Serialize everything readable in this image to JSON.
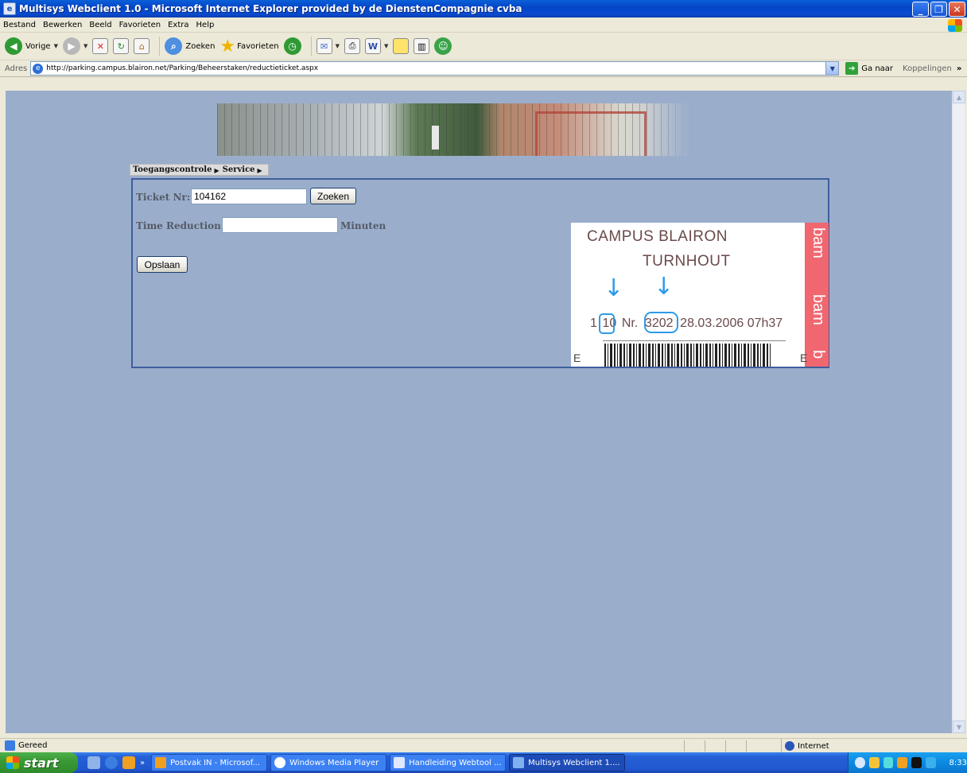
{
  "window": {
    "title": "Multisys Webclient 1.0 - Microsoft Internet Explorer provided by de DienstenCompagnie cvba"
  },
  "menu": [
    "Bestand",
    "Bewerken",
    "Beeld",
    "Favorieten",
    "Extra",
    "Help"
  ],
  "toolbar": {
    "back_label": "Vorige",
    "search_label": "Zoeken",
    "favorites_label": "Favorieten"
  },
  "address": {
    "label": "Adres",
    "url": "http://parking.campus.blairon.net/Parking/Beheerstaken/reductieticket.aspx",
    "go_label": "Ga naar",
    "links_label": "Koppelingen"
  },
  "breadcrumb": [
    "Toegangscontrole",
    "Service"
  ],
  "form": {
    "ticket_label": "Ticket Nr:",
    "ticket_value": "104162",
    "search_button": "Zoeken",
    "reduction_label": "Time Reduction:",
    "reduction_value": "",
    "unit_label": "Minuten",
    "save_button": "Opslaan"
  },
  "ticket_image": {
    "line1": "CAMPUS BLAIRON",
    "line2": "TURNHOUT",
    "prefix": "1",
    "num1": "10",
    "nr_label": "Nr.",
    "num2": "3202",
    "datetime": "28.03.2006 07h37",
    "stripe_text1": "bam",
    "stripe_text2": "bam",
    "stripe_text3": "b",
    "corner_left": "E",
    "corner_right": "E"
  },
  "status": {
    "text": "Gereed",
    "zone": "Internet"
  },
  "taskbar": {
    "start_label": "start",
    "tasks": [
      "Postvak IN - Microsof...",
      "Windows Media Player",
      "Handleiding Webtool ...",
      "Multisys Webclient 1...."
    ],
    "clock": "8:33"
  },
  "colors": {
    "page_background": "#9aaecc",
    "panel_border": "#3e5e9c",
    "ticket_stripe": "#f06770",
    "annotation_blue": "#2e9be8"
  }
}
